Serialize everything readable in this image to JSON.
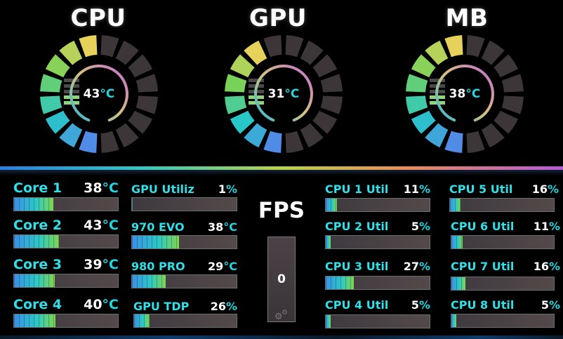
{
  "gauges": [
    {
      "title": "CPU",
      "temp": "43",
      "unit": "°C",
      "fraction": 0.43
    },
    {
      "title": "GPU",
      "temp": "31",
      "unit": "°C",
      "fraction": 0.31
    },
    {
      "title": "MB",
      "temp": "38",
      "unit": "°C",
      "fraction": 0.38
    }
  ],
  "stats": {
    "core1": {
      "label": "Core 1",
      "value": "38",
      "unit": "°C",
      "fraction": 0.38
    },
    "core2": {
      "label": "Core 2",
      "value": "43",
      "unit": "°C",
      "fraction": 0.43
    },
    "core3": {
      "label": "Core 3",
      "value": "39",
      "unit": "°C",
      "fraction": 0.39
    },
    "core4": {
      "label": "Core 4",
      "value": "40",
      "unit": "°C",
      "fraction": 0.4
    },
    "gpu_util": {
      "label": "GPU Utiliz",
      "value": "1",
      "unit": "%",
      "fraction": 0.01
    },
    "evo970": {
      "label": "970 EVO",
      "value": "38",
      "unit": "°C",
      "fraction": 0.45
    },
    "pro980": {
      "label": "980 PRO",
      "value": "29",
      "unit": "°C",
      "fraction": 0.32
    },
    "gpu_tdp": {
      "label": "GPU TDP",
      "value": "26",
      "unit": "%",
      "fraction": 0.15
    },
    "cpu1": {
      "label": "CPU 1 Util",
      "value": "11",
      "unit": "%",
      "fraction": 0.11
    },
    "cpu2": {
      "label": "CPU 2 Util",
      "value": "5",
      "unit": "%",
      "fraction": 0.05
    },
    "cpu3": {
      "label": "CPU 3 Util",
      "value": "27",
      "unit": "%",
      "fraction": 0.27
    },
    "cpu4": {
      "label": "CPU 4 Util",
      "value": "5",
      "unit": "%",
      "fraction": 0.05
    },
    "cpu5": {
      "label": "CPU 5 Util",
      "value": "16",
      "unit": "%",
      "fraction": 0.1
    },
    "cpu6": {
      "label": "CPU 6 Util",
      "value": "11",
      "unit": "%",
      "fraction": 0.11
    },
    "cpu7": {
      "label": "CPU 7 Util",
      "value": "16",
      "unit": "%",
      "fraction": 0.14
    },
    "cpu8": {
      "label": "CPU 8 Util",
      "value": "5",
      "unit": "%",
      "fraction": 0.05
    }
  },
  "fps": {
    "title": "FPS",
    "value": "0",
    "fraction": 0
  }
}
